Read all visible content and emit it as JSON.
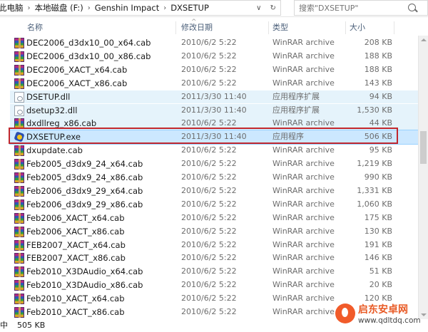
{
  "address": {
    "crumbs": [
      "此电脑",
      "本地磁盘 (F:)",
      "Genshin Impact",
      "DXSETUP"
    ],
    "separator": "›",
    "dropdown": "∨",
    "refresh": "↻"
  },
  "search": {
    "placeholder": "搜索\"DXSETUP\""
  },
  "columns": {
    "name": "名称",
    "date": "修改日期",
    "type": "类型",
    "size": "大小",
    "sort_indicator": "^"
  },
  "rows": [
    {
      "name": "DEC2006_d3dx10_00_x64.cab",
      "date": "2010/6/2 5:22",
      "type": "WinRAR archive",
      "size": "208 KB",
      "icon": "rar-icon"
    },
    {
      "name": "DEC2006_d3dx10_00_x86.cab",
      "date": "2010/6/2 5:22",
      "type": "WinRAR archive",
      "size": "188 KB",
      "icon": "rar-icon"
    },
    {
      "name": "DEC2006_XACT_x64.cab",
      "date": "2010/6/2 5:22",
      "type": "WinRAR archive",
      "size": "188 KB",
      "icon": "rar-icon"
    },
    {
      "name": "DEC2006_XACT_x86.cab",
      "date": "2010/6/2 5:22",
      "type": "WinRAR archive",
      "size": "143 KB",
      "icon": "rar-icon"
    },
    {
      "name": "DSETUP.dll",
      "date": "2011/3/30 11:40",
      "type": "应用程序扩展",
      "size": "94 KB",
      "icon": "dll-icon"
    },
    {
      "name": "dsetup32.dll",
      "date": "2011/3/30 11:40",
      "type": "应用程序扩展",
      "size": "1,530 KB",
      "icon": "dll-icon"
    },
    {
      "name": "dxdllreg_x86.cab",
      "date": "2010/6/2 5:22",
      "type": "WinRAR archive",
      "size": "44 KB",
      "icon": "rar-icon"
    },
    {
      "name": "DXSETUP.exe",
      "date": "2011/3/30 11:40",
      "type": "应用程序",
      "size": "506 KB",
      "icon": "exe-icon"
    },
    {
      "name": "dxupdate.cab",
      "date": "2010/6/2 5:22",
      "type": "WinRAR archive",
      "size": "95 KB",
      "icon": "rar-icon"
    },
    {
      "name": "Feb2005_d3dx9_24_x64.cab",
      "date": "2010/6/2 5:22",
      "type": "WinRAR archive",
      "size": "1,219 KB",
      "icon": "rar-icon"
    },
    {
      "name": "Feb2005_d3dx9_24_x86.cab",
      "date": "2010/6/2 5:22",
      "type": "WinRAR archive",
      "size": "990 KB",
      "icon": "rar-icon"
    },
    {
      "name": "Feb2006_d3dx9_29_x64.cab",
      "date": "2010/6/2 5:22",
      "type": "WinRAR archive",
      "size": "1,331 KB",
      "icon": "rar-icon"
    },
    {
      "name": "Feb2006_d3dx9_29_x86.cab",
      "date": "2010/6/2 5:22",
      "type": "WinRAR archive",
      "size": "1,060 KB",
      "icon": "rar-icon"
    },
    {
      "name": "Feb2006_XACT_x64.cab",
      "date": "2010/6/2 5:22",
      "type": "WinRAR archive",
      "size": "175 KB",
      "icon": "rar-icon"
    },
    {
      "name": "Feb2006_XACT_x86.cab",
      "date": "2010/6/2 5:22",
      "type": "WinRAR archive",
      "size": "130 KB",
      "icon": "rar-icon"
    },
    {
      "name": "FEB2007_XACT_x64.cab",
      "date": "2010/6/2 5:22",
      "type": "WinRAR archive",
      "size": "191 KB",
      "icon": "rar-icon"
    },
    {
      "name": "FEB2007_XACT_x86.cab",
      "date": "2010/6/2 5:22",
      "type": "WinRAR archive",
      "size": "146 KB",
      "icon": "rar-icon"
    },
    {
      "name": "Feb2010_X3DAudio_x64.cab",
      "date": "2010/6/2 5:22",
      "type": "WinRAR archive",
      "size": "51 KB",
      "icon": "rar-icon"
    },
    {
      "name": "Feb2010_X3DAudio_x86.cab",
      "date": "2010/6/2 5:22",
      "type": "WinRAR archive",
      "size": "20 KB",
      "icon": "rar-icon"
    },
    {
      "name": "Feb2010_XACT_x64.cab",
      "date": "2010/6/2 5:22",
      "type": "WinRAR archive",
      "size": "120 KB",
      "icon": "rar-icon"
    },
    {
      "name": "Feb2010_XACT_x86.cab",
      "date": "2010/6/2 5:22",
      "type": "WinRAR archive",
      "size": "",
      "icon": "rar-icon"
    }
  ],
  "highlighted_rows": [
    4,
    5,
    6
  ],
  "selected_row": 7,
  "status": {
    "selection": "中",
    "size": "505 KB"
  },
  "watermark": {
    "title": "启东安卓网",
    "url": "www.qdltdq.com"
  },
  "colors": {
    "selection_bg": "#cce8ff",
    "hover_bg": "#e5f3fb",
    "annotation_box": "#c1272d",
    "header_text": "#4c607a"
  }
}
